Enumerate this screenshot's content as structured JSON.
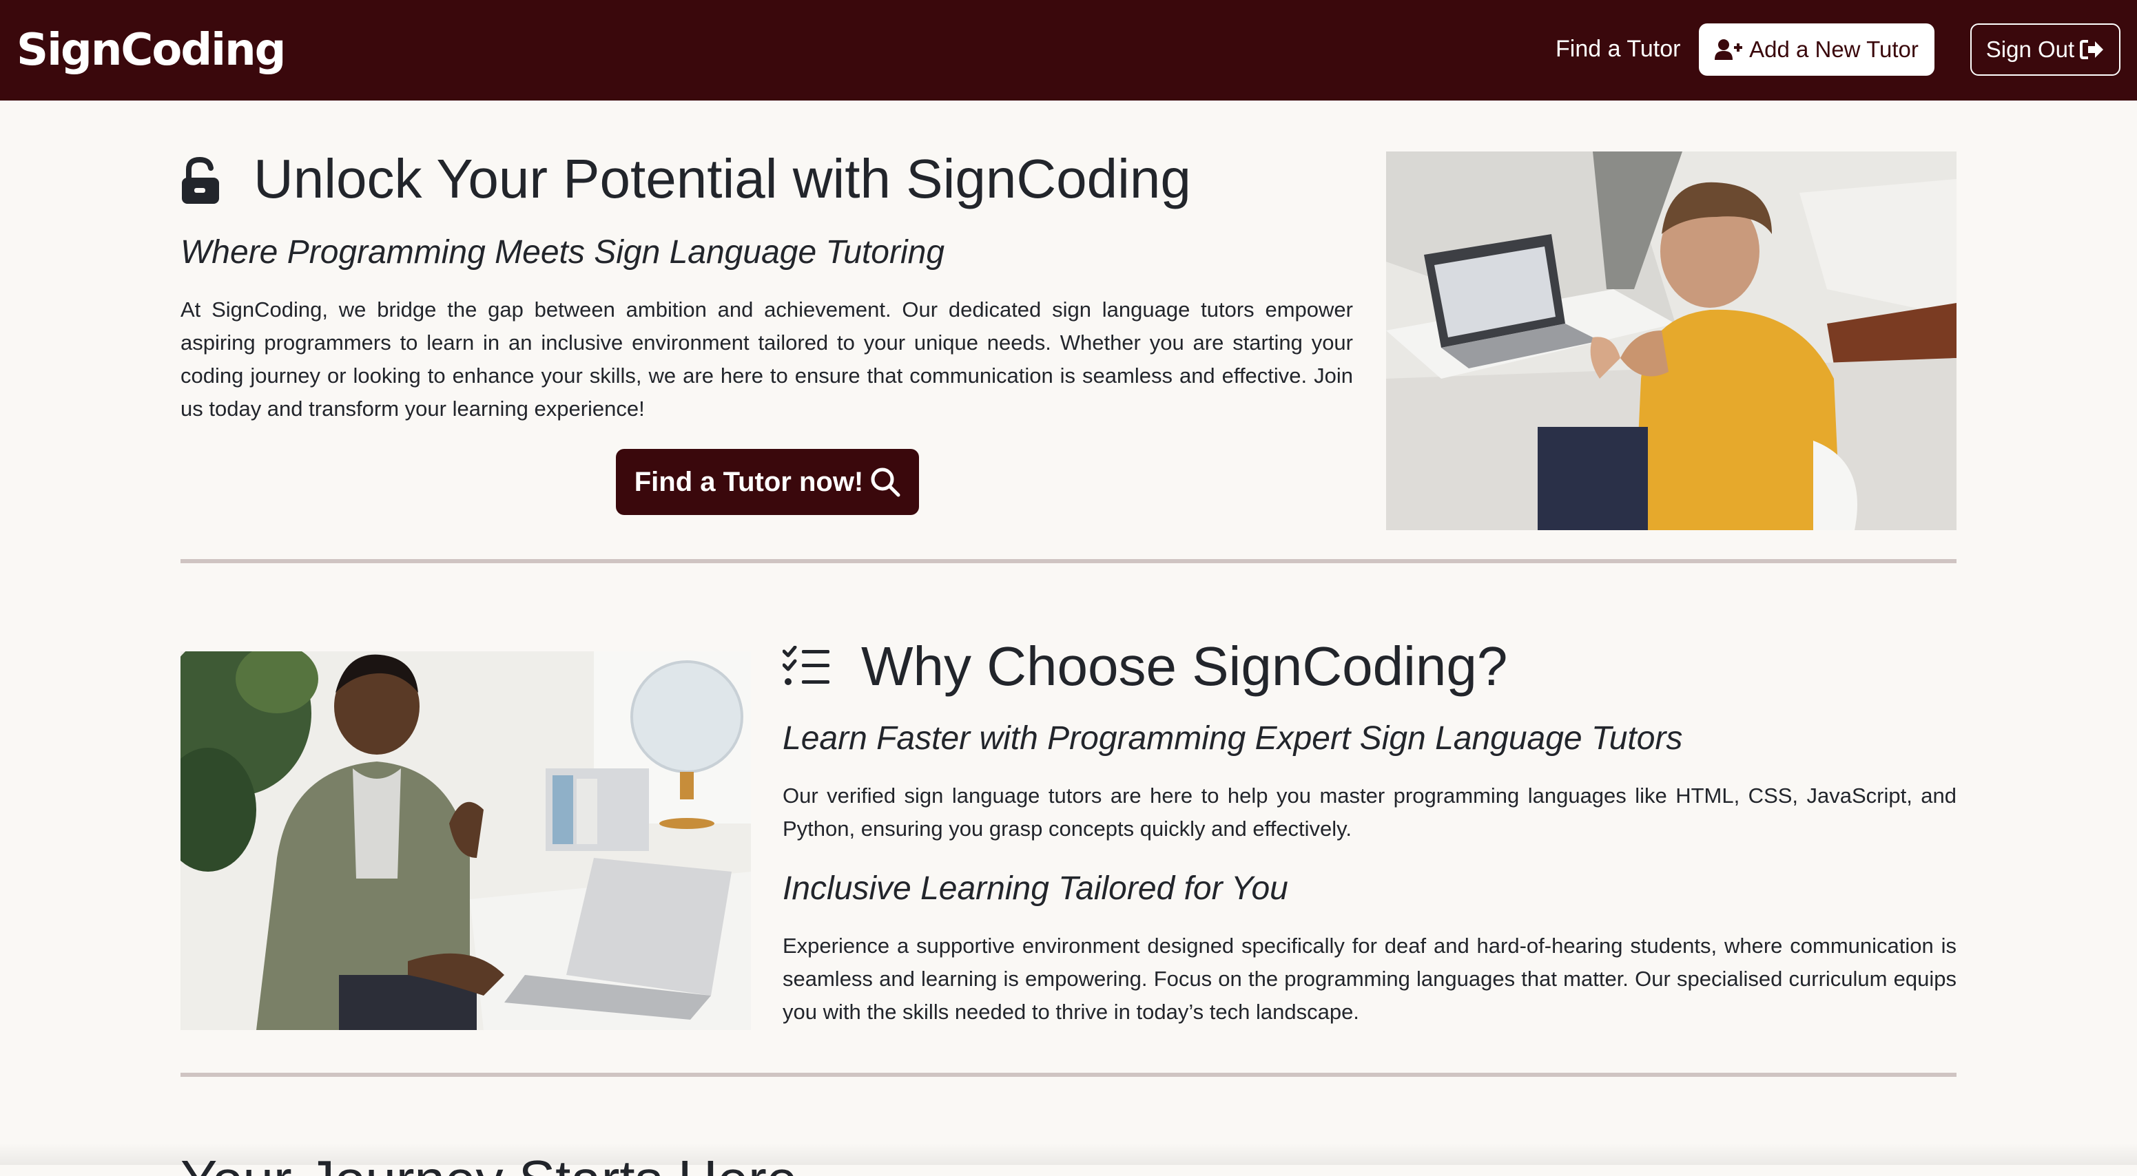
{
  "navbar": {
    "brand": "SignCoding",
    "find_tutor_link": "Find a Tutor",
    "add_tutor_button": "Add a New Tutor",
    "add_tutor_icon": "user-plus-icon",
    "sign_out_button": "Sign Out",
    "sign_out_icon": "sign-out-icon",
    "background_color": "#3a080c"
  },
  "hero": {
    "icon": "unlock-icon",
    "title": "Unlock Your Potential with SignCoding",
    "subtitle": "Where Programming Meets Sign Language Tutoring",
    "body": "At SignCoding, we bridge the gap between ambition and achievement. Our dedicated sign language tutors empower aspiring programmers to learn in an inclusive environment tailored to your unique needs. Whether you are starting your coding journey or looking to enhance your skills, we are here to ensure that communication is seamless and effective. Join us today and transform your learning experience!",
    "cta_label": "Find a Tutor now!",
    "cta_icon": "search-icon",
    "image": "student-with-laptop-photo"
  },
  "why": {
    "icon": "checklist-icon",
    "title": "Why Choose SignCoding?",
    "image": "man-signing-at-laptop-photo",
    "points": [
      {
        "heading": "Learn Faster with Programming Expert Sign Language Tutors",
        "body": "Our verified sign language tutors are here to help you master programming languages like HTML, CSS, JavaScript, and Python, ensuring you grasp concepts quickly and effectively."
      },
      {
        "heading": "Inclusive Learning Tailored for You",
        "body": "Experience a supportive environment designed specifically for deaf and hard-of-hearing students, where communication is seamless and learning is empowering. Focus on the programming languages that matter. Our specialised curriculum equips you with the skills needed to thrive in today’s tech landscape."
      }
    ]
  },
  "next_section": {
    "title_partial": "Your Journey Starts Here"
  },
  "colors": {
    "accent": "#3a080c",
    "page_background": "#faf8f5",
    "divider": "#cfc4c2"
  }
}
